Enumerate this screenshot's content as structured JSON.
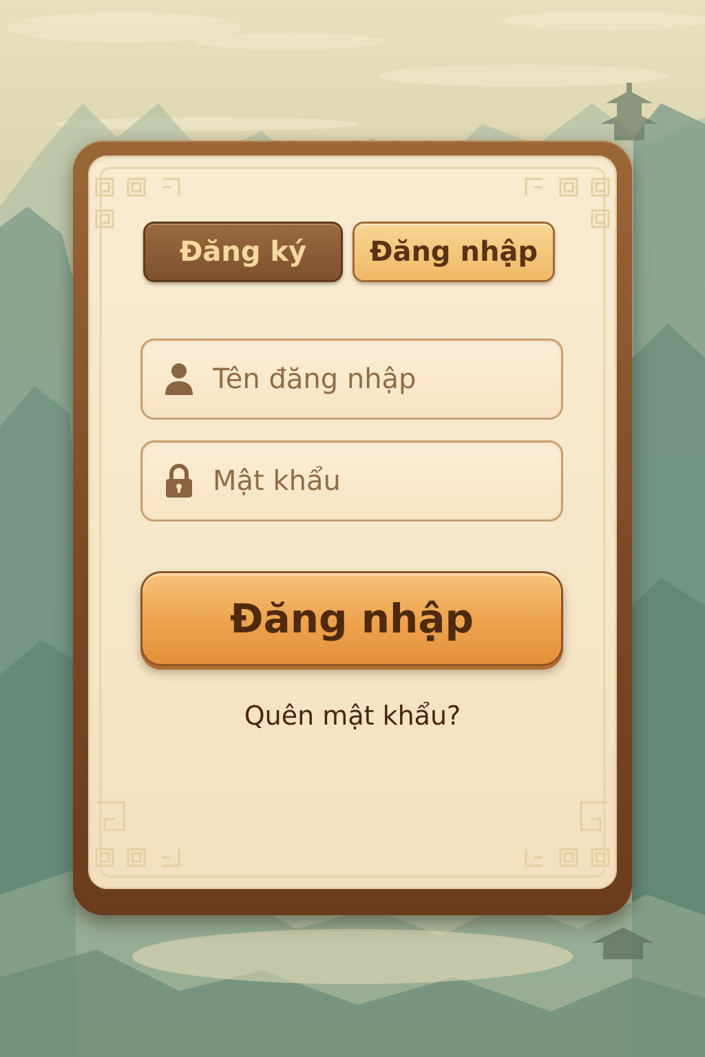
{
  "tabs": {
    "register_label": "Đăng ký",
    "login_label": "Đăng nhập",
    "active": "login"
  },
  "form": {
    "username": {
      "placeholder": "Tên đăng nhập",
      "value": "",
      "icon": "user-icon"
    },
    "password": {
      "placeholder": "Mật khẩu",
      "value": "",
      "icon": "lock-icon"
    },
    "submit_label": "Đăng nhập",
    "forgot_label": "Quên mật khẩu?"
  },
  "colors": {
    "frame": "#7b4a26",
    "panel": "#f6e6c8",
    "tab_inactive": "#8a5c33",
    "tab_active": "#f3c678",
    "submit": "#eda24c",
    "text_dark": "#4a2410"
  }
}
